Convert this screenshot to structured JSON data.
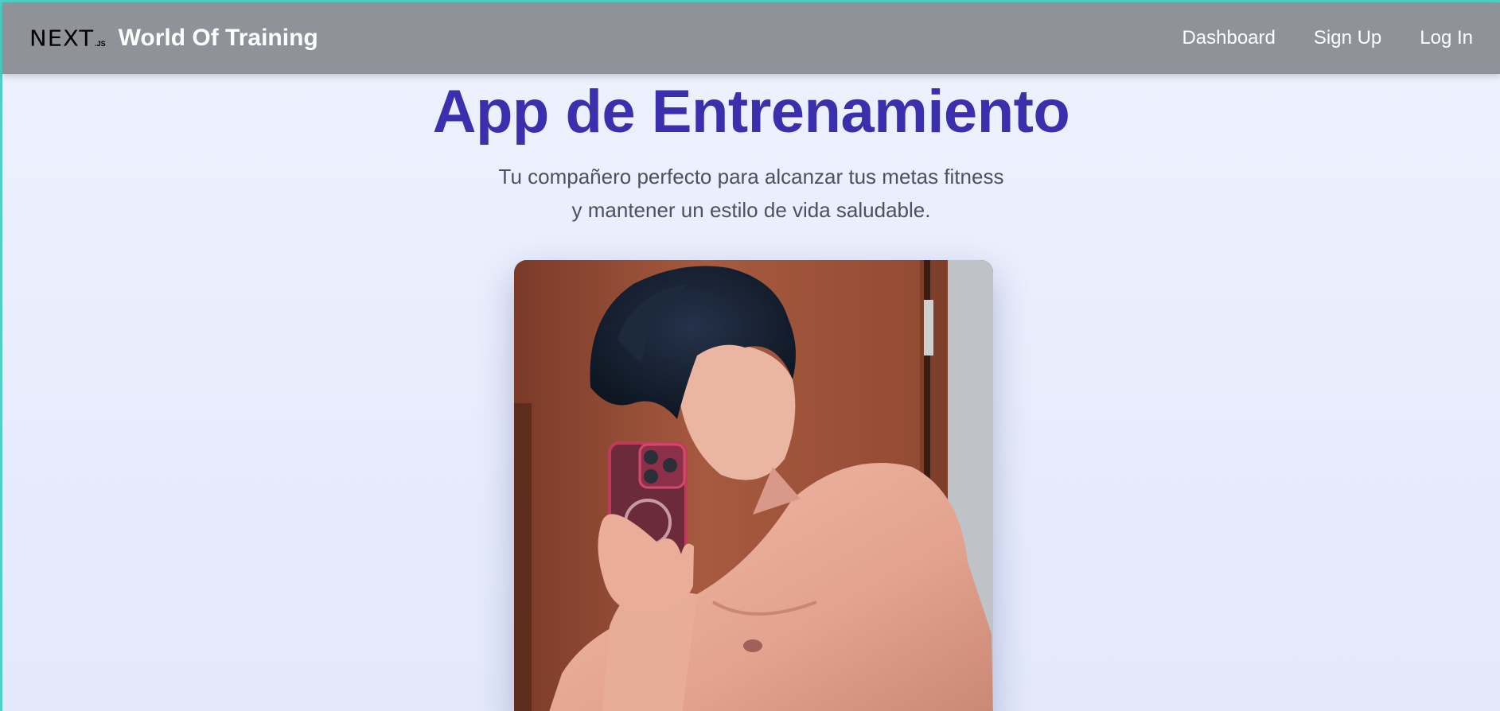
{
  "navbar": {
    "logo_text": "NEXT",
    "logo_suffix": ".JS",
    "brand_title": "World Of Training",
    "links": [
      {
        "label": "Dashboard"
      },
      {
        "label": "Sign Up"
      },
      {
        "label": "Log In"
      }
    ]
  },
  "hero": {
    "title": "App de Entrenamiento",
    "subtitle_line1": "Tu compañero perfecto para alcanzar tus metas fitness",
    "subtitle_line2": "y mantener un estilo de vida saludable."
  },
  "colors": {
    "navbar": "#8f9399",
    "title": "#3a2fad",
    "background": "#eef2fe",
    "accent_border": "#4fd1c5"
  }
}
